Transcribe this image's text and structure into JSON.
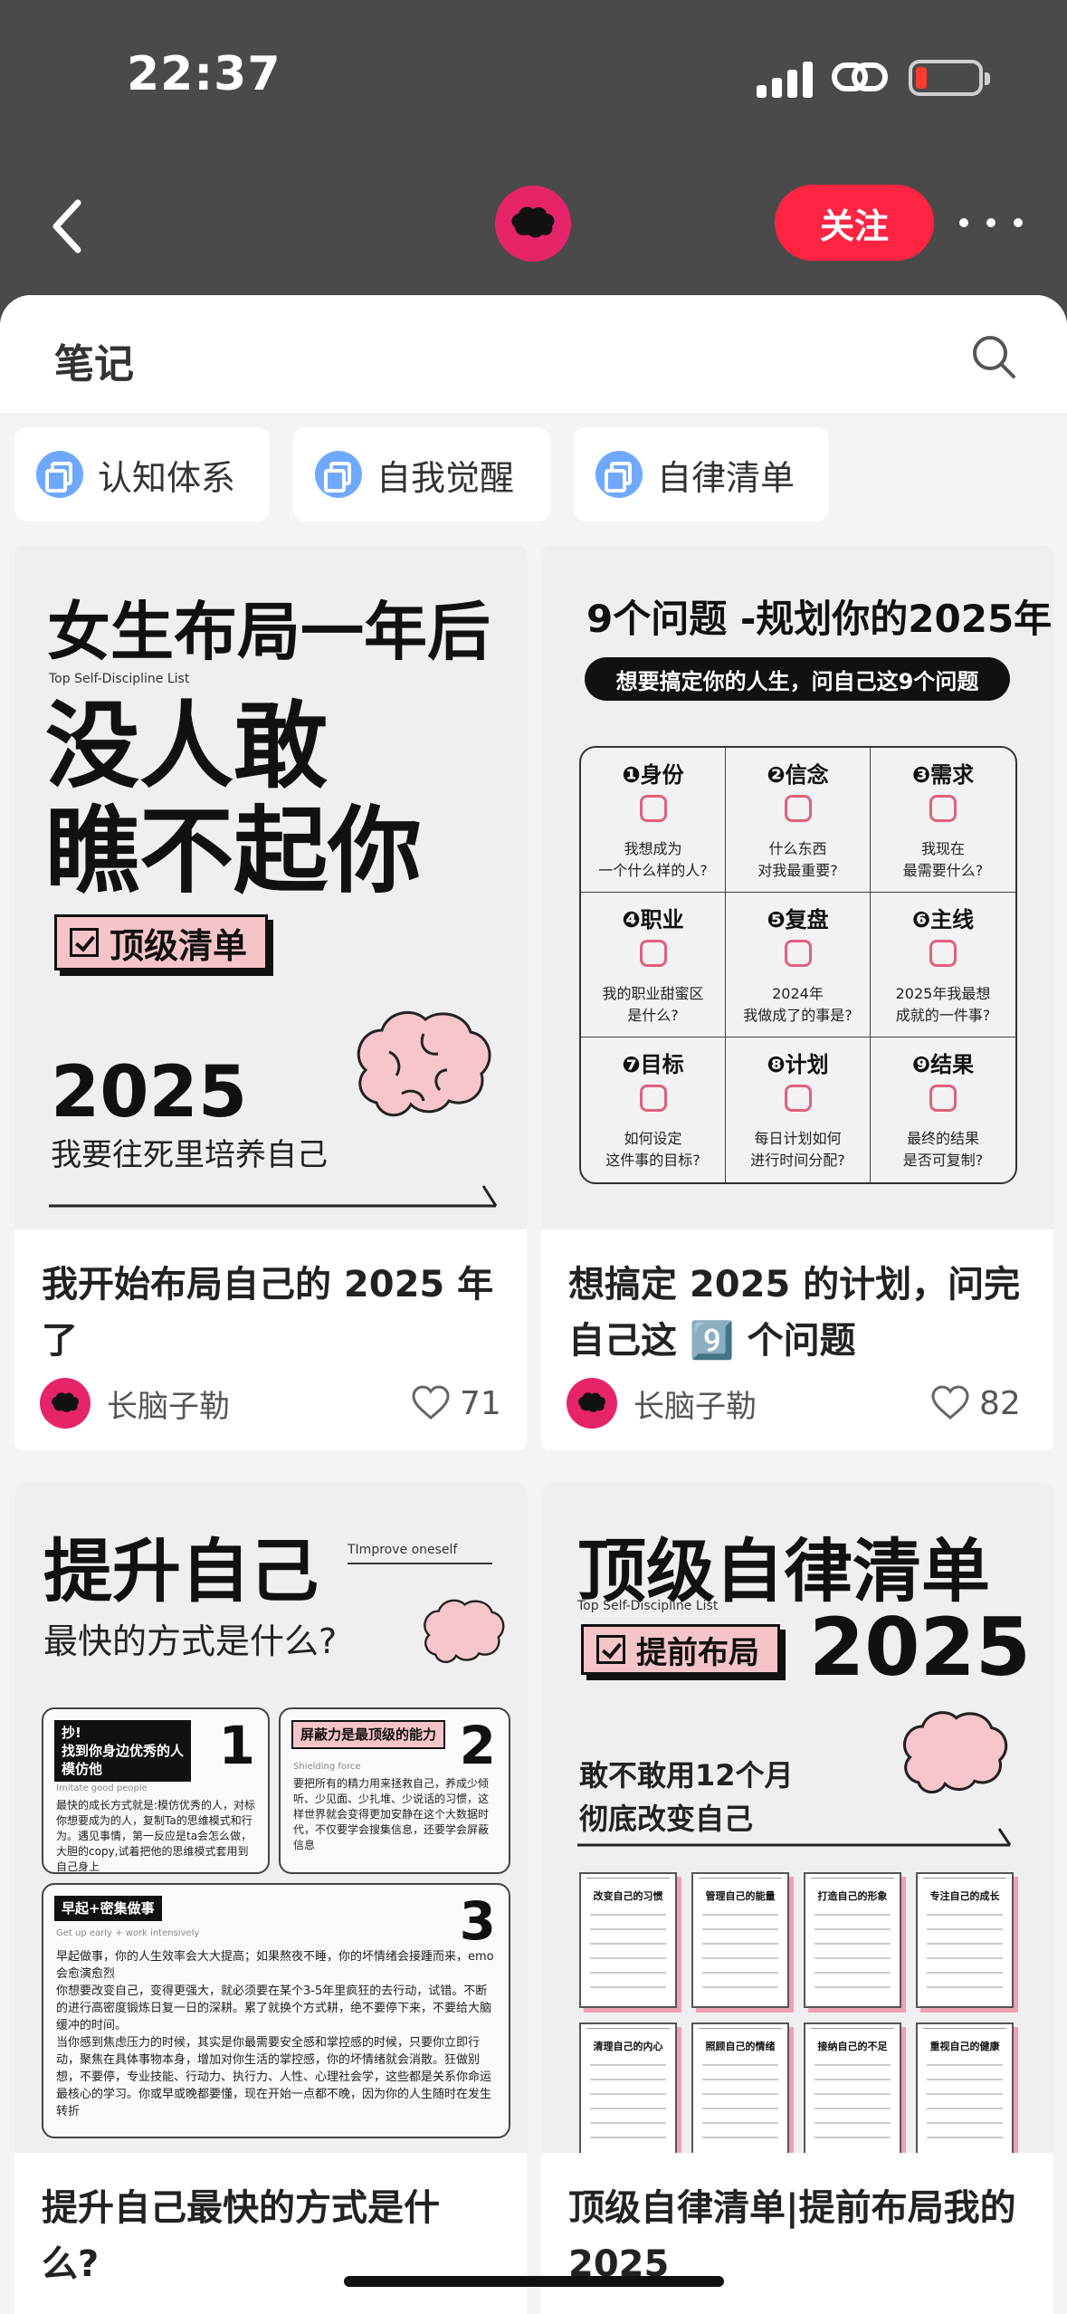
{
  "status_bar": {
    "time": "22:37"
  },
  "header": {
    "follow_label": "关注"
  },
  "sheet": {
    "title": "笔记"
  },
  "chips": [
    "认知体系",
    "自我觉醒",
    "自律清单"
  ],
  "notes": [
    {
      "title": "我开始布局自己的 2025 年了",
      "author": "长脑子勒",
      "likes": "71",
      "cover": {
        "line1": "女生布局一年后",
        "subtitle_en": "Top Self-Discipline List",
        "line2": "没人敢",
        "line3": "瞧不起你",
        "badge": "顶级清单",
        "year": "2025",
        "slogan": "我要往死里培养自己"
      }
    },
    {
      "title": "想搞定 2025 的计划，问完自己这 9️⃣ 个问题",
      "author": "长脑子勒",
      "likes": "82",
      "cover": {
        "title": "9个问题 -规划你的2025年",
        "pill": "想要搞定你的人生，问自己这9个问题",
        "cells": [
          {
            "head": "❶身份",
            "q": "我想成为\n一个什么样的人?"
          },
          {
            "head": "❷信念",
            "q": "什么东西\n对我最重要?"
          },
          {
            "head": "❸需求",
            "q": "我现在\n最需要什么?"
          },
          {
            "head": "❹职业",
            "q": "我的职业甜蜜区\n是什么?"
          },
          {
            "head": "❺复盘",
            "q": "2024年\n我做成了的事是?"
          },
          {
            "head": "❻主线",
            "q": "2025年我最想\n成就的一件事?"
          },
          {
            "head": "❼目标",
            "q": "如何设定\n这件事的目标?"
          },
          {
            "head": "❽计划",
            "q": "每日计划如何\n进行时间分配?"
          },
          {
            "head": "❾结果",
            "q": "最终的结果\n是否可复制?"
          }
        ]
      }
    },
    {
      "title": "提升自己最快的方式是什么?",
      "cover": {
        "title": "提升自己",
        "title_en": "TImprove oneself",
        "subtitle": "最快的方式是什么?",
        "tips": [
          {
            "head": "抄!\n找到你身边优秀的人\n模仿他",
            "num": "1",
            "en": "Imitate good people",
            "body": "最快的成长方式就是:模仿优秀的人，对标你想要成为的人，复制Ta的思维模式和行为。遇见事情，第一反应是ta会怎么做，大胆的copy,试着把他的思维模式套用到自己身上"
          },
          {
            "head": "屏蔽力是最顶级的能力",
            "num": "2",
            "en": "Shielding force",
            "body": "要把所有的精力用来拯救自己，养成少倾听、少见面、少扎堆、少说话的习惯，这样世界就会变得更加安静在这个大数据时代，不仅要学会搜集信息，还要学会屏蔽信息"
          },
          {
            "head": "早起+密集做事",
            "num": "3",
            "en": "Get up early + work intensively",
            "body": "早起做事，你的人生效率会大大提高；如果熬夜不睡，你的坏情绪会接踵而来，emo会愈演愈烈\n你想要改变自己，变得更强大，就必须要在某个3-5年里疯狂的去行动，试错。不断的进行高密度锻炼日复一日的深耕。累了就换个方式耕，绝不要停下来，不要给大脑缓冲的时间。\n当你感到焦虑压力的时候，其实是你最需要安全感和掌控感的时候，只要你立即行动，聚焦在具体事物本身，增加对你生活的掌控感，你的坏情绪就会消散。狂做别想，不要停，专业技能、行动力、执行力、人性、心理社会学，这些都是关系你命运最核心的学习。你或早或晚都要懂，现在开始一点都不晚，因为你的人生随时在发生转折"
          }
        ]
      }
    },
    {
      "title": "顶级自律清单|提前布局我的 2025",
      "cover": {
        "title": "顶级自律清单",
        "subtitle_en": "Top Self-Discipline List",
        "badge": "提前布局",
        "year": "2025",
        "line1": "敢不敢用12个月",
        "line2": "彻底改变自己",
        "sheets": [
          "改变自己的习惯",
          "管理自己的能量",
          "打造自己的形象",
          "专注自己的成长",
          "清理自己的内心",
          "照顾自己的情绪",
          "接纳自己的不足",
          "重视自己的健康"
        ]
      }
    }
  ]
}
